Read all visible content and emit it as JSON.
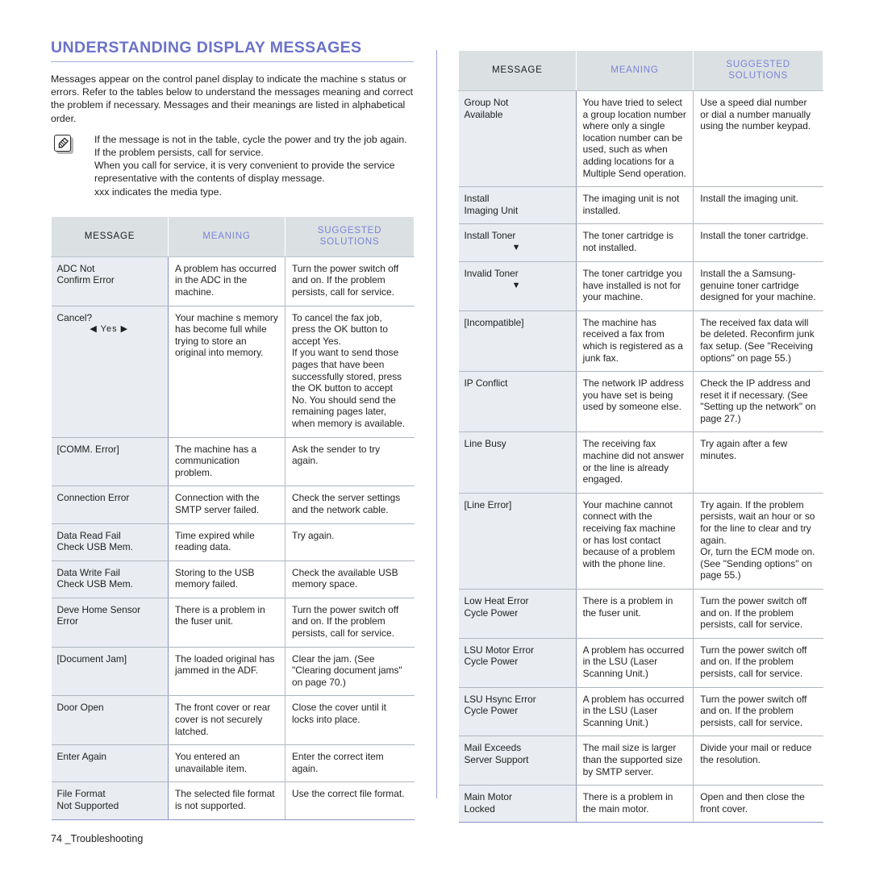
{
  "document": {
    "section_title": "UNDERSTANDING DISPLAY MESSAGES",
    "intro": "Messages appear on the control panel display to indicate the machine s status or errors. Refer to the tables below to understand the messages meaning and correct the problem if necessary. Messages and their meanings are listed in alphabetical order.",
    "footer": "74 _Troubleshooting"
  },
  "note": {
    "icon": "note-pen-icon",
    "line1": "If the message is not in the table, cycle the power and try the job again. If the problem persists, call for service.",
    "line2": "When you call for service, it is very convenient to provide the service representative with the contents of display message.",
    "line3": "xxx indicates the media type."
  },
  "colors": {
    "heading": "#6b72c9",
    "header_accent": "#7b82d8",
    "header_bg": "#dbe1e2",
    "msg_cell_bg": "#e9edf1",
    "divider": "#9aa0dc"
  },
  "table_headers": {
    "message": "MESSAGE",
    "meaning": "MEANING",
    "solutions_line1": "SUGGESTED",
    "solutions_line2": "SOLUTIONS"
  },
  "left_table": {
    "rows": [
      {
        "message": "ADC Not\nConfirm Error",
        "meaning": "A problem has occurred in the ADC in the machine.",
        "solution": "Turn the power switch off and on. If the problem persists, call for service."
      },
      {
        "message": "Cancel?",
        "message_arrows": "◀ Yes ▶",
        "meaning": "Your machine s memory has become full while trying to store an original into memory.",
        "solution": "To cancel the fax job, press the OK button to accept Yes.\nIf you want to send those pages that have been successfully stored, press the OK button to accept No. You should send the remaining pages later, when memory is available."
      },
      {
        "message": "[COMM. Error]",
        "meaning": "The machine has a communication problem.",
        "solution": "Ask the sender to try again."
      },
      {
        "message": "Connection Error",
        "meaning": "Connection with the SMTP server failed.",
        "solution": "Check the server settings and the network cable."
      },
      {
        "message": "Data Read Fail\nCheck USB Mem.",
        "meaning": "Time expired while reading data.",
        "solution": "Try again."
      },
      {
        "message": "Data Write Fail\nCheck USB Mem.",
        "meaning": "Storing to the USB memory failed.",
        "solution": "Check the available USB memory space."
      },
      {
        "message": "Deve Home Sensor\nError",
        "meaning": "There is a problem in the fuser unit.",
        "solution": "Turn the power switch off and on. If the problem persists, call for service."
      },
      {
        "message": "[Document Jam]",
        "meaning": "The loaded original has jammed in the ADF.",
        "solution": "Clear the jam. (See \"Clearing document jams\" on page 70.)"
      },
      {
        "message": "Door Open",
        "meaning": "The front cover or rear cover is not securely latched.",
        "solution": "Close the cover until it locks into place."
      },
      {
        "message": "Enter Again",
        "meaning": "You entered an unavailable item.",
        "solution": "Enter the correct item again."
      },
      {
        "message": "File Format\nNot Supported",
        "meaning": "The selected file format is not supported.",
        "solution": "Use the correct file format."
      }
    ]
  },
  "right_table": {
    "rows": [
      {
        "message": "Group Not\nAvailable",
        "meaning": "You have tried to select a group location number where only a single location number can be used, such as when adding locations for a Multiple Send operation.",
        "solution": "Use a speed dial number or dial a number manually using the number keypad."
      },
      {
        "message": "Install\nImaging Unit",
        "meaning": "The imaging unit is not installed.",
        "solution": "Install the imaging unit."
      },
      {
        "message": "Install Toner",
        "message_arrows": "▼",
        "meaning": "The toner cartridge is not installed.",
        "solution": "Install the toner cartridge."
      },
      {
        "message": "Invalid Toner",
        "message_arrows": "▼",
        "meaning": "The toner cartridge you have installed is not for your machine.",
        "solution": "Install the a Samsung-genuine toner cartridge designed for your machine."
      },
      {
        "message": "[Incompatible]",
        "meaning": "The machine has received a fax from which is registered as a junk fax.",
        "solution": "The received fax data will be deleted. Reconfirm junk fax setup. (See \"Receiving options\" on page 55.)"
      },
      {
        "message": "IP Conflict",
        "meaning": "The network IP address you have set is being used by someone else.",
        "solution": "Check the IP address and reset it if necessary. (See \"Setting up the network\" on page 27.)"
      },
      {
        "message": "Line Busy",
        "meaning": "The receiving fax machine did not answer or the line is already engaged.",
        "solution": "Try again after a few minutes."
      },
      {
        "message": "[Line Error]",
        "meaning": "Your machine cannot connect with the receiving fax machine or has lost contact because of a problem with the phone line.",
        "solution": "Try again. If the problem persists, wait an hour or so for the line to clear and try again.\nOr, turn the ECM mode on. (See \"Sending options\" on page 55.)"
      },
      {
        "message": "Low Heat Error\nCycle Power",
        "meaning": "There is a problem in the fuser unit.",
        "solution": "Turn the power switch off and on. If the problem persists, call for service."
      },
      {
        "message": "LSU Motor Error\nCycle Power",
        "meaning": "A problem has occurred in the LSU (Laser Scanning Unit.)",
        "solution": "Turn the power switch off and on. If the problem persists, call for service."
      },
      {
        "message": "LSU Hsync Error\nCycle Power",
        "meaning": "A problem has occurred in the LSU (Laser Scanning Unit.)",
        "solution": "Turn the power switch off and on. If the problem persists, call for service."
      },
      {
        "message": "Mail Exceeds\nServer Support",
        "meaning": "The mail size is larger than the supported size by SMTP server.",
        "solution": "Divide your mail or reduce the resolution."
      },
      {
        "message": "Main Motor\nLocked",
        "meaning": "There is a problem in the main motor.",
        "solution": "Open and then close the front cover."
      }
    ]
  }
}
